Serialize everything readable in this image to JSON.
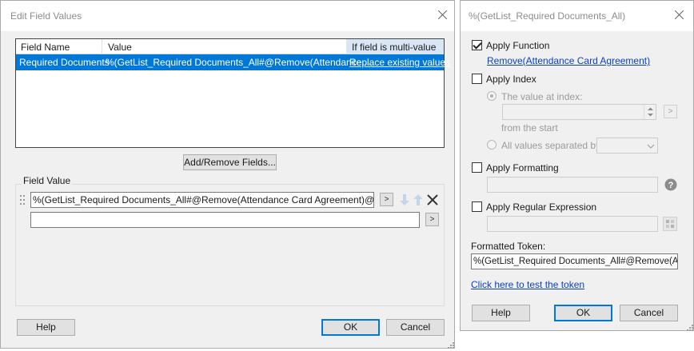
{
  "left_dialog": {
    "title": "Edit Field Values",
    "columns": {
      "field_name": "Field Name",
      "value": "Value",
      "multi": "If field is multi-value"
    },
    "row": {
      "field_name": "Required Documents",
      "value": "%(GetList_Required Documents_All#@Remove(Attendance ...",
      "multi": "Replace existing values"
    },
    "add_remove_label": "Add/Remove Fields...",
    "field_value_group_label": "Field Value",
    "field_value_1": "%(GetList_Required Documents_All#@Remove(Attendance Card Agreement)@#)",
    "field_value_2": "",
    "more_button_1": ">",
    "more_button_2": ">",
    "help_label": "Help",
    "ok_label": "OK",
    "cancel_label": "Cancel"
  },
  "right_dialog": {
    "title": "%(GetList_Required Documents_All)",
    "apply_function": {
      "label": "Apply Function",
      "checked": true,
      "link": "Remove(Attendance Card Agreement)"
    },
    "apply_index": {
      "label": "Apply Index",
      "checked": false,
      "value_at_index_label": "The value at index:",
      "index_value": "",
      "from_the_label": "from the  start",
      "all_values_label": "All values separated by:",
      "separator_value": "",
      "go_button": ">"
    },
    "apply_formatting": {
      "label": "Apply Formatting",
      "checked": false,
      "value": ""
    },
    "apply_regex": {
      "label": "Apply Regular Expression",
      "checked": false,
      "value": ""
    },
    "formatted_token_label": "Formatted Token:",
    "formatted_token_value": "%(GetList_Required Documents_All#@Remove(Attendance",
    "test_link": "Click here to test the token",
    "help_label": "Help",
    "ok_label": "OK",
    "cancel_label": "Cancel"
  },
  "icons": [
    "close-icon",
    "drag-handle-icon",
    "arrow-down-icon",
    "arrow-up-icon",
    "delete-icon",
    "help-icon",
    "regex-builder-icon",
    "spin-up-icon",
    "spin-down-icon",
    "dropdown-chevron-icon",
    "resize-grip-icon"
  ],
  "colors": {
    "selection": "#0078d7",
    "link": "#0b3fc4",
    "accent_border": "#0078d7"
  }
}
